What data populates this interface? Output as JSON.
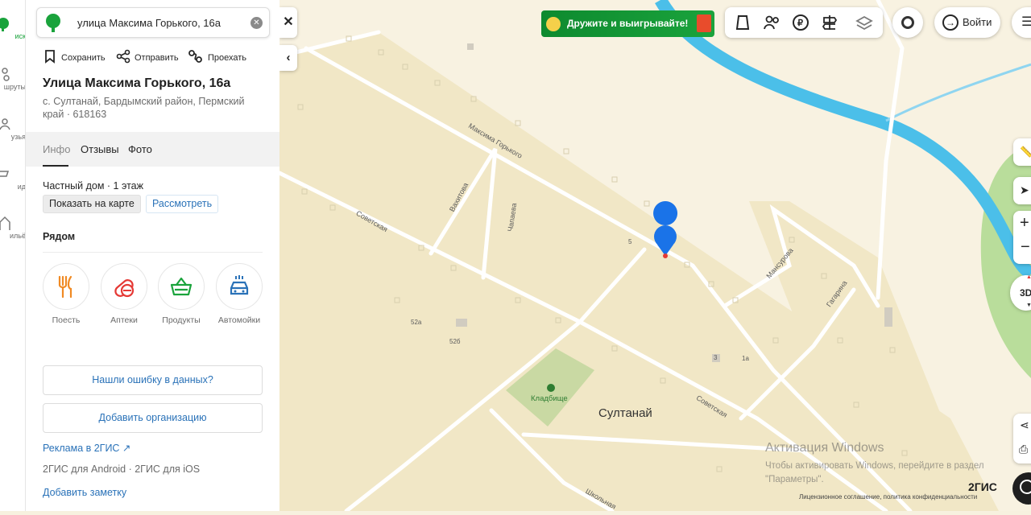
{
  "rail": {
    "items": [
      {
        "label": "иск",
        "icon": "search-icon"
      },
      {
        "label": "шруты",
        "icon": "route-icon"
      },
      {
        "label": "узья",
        "icon": "friends-icon"
      },
      {
        "label": "ид",
        "icon": "guide-icon"
      },
      {
        "label": "ильё",
        "icon": "housing-icon"
      }
    ]
  },
  "search": {
    "value": "улица Максима Горького, 16а",
    "clear_icon": "close-circle-icon"
  },
  "actions": {
    "save": "Сохранить",
    "share": "Отправить",
    "route": "Проехать"
  },
  "place": {
    "title": "Улица Максима Горького, 16а",
    "address": "с. Султанай, Бардымский район, Пермский край · 618163"
  },
  "tabs": {
    "info": "Инфо",
    "reviews": "Отзывы",
    "photo": "Фото"
  },
  "details": {
    "property": "Частный дом · 1 этаж",
    "show_on_map": "Показать на карте",
    "inspect": "Рассмотреть"
  },
  "nearby": {
    "title": "Рядом",
    "categories": [
      {
        "label": "Поесть",
        "icon": "fork-knife-icon"
      },
      {
        "label": "Аптеки",
        "icon": "pill-icon"
      },
      {
        "label": "Продукты",
        "icon": "basket-icon"
      },
      {
        "label": "Автомойки",
        "icon": "car-wash-icon"
      }
    ]
  },
  "footer": {
    "report_error": "Нашли ошибку в данных?",
    "add_org": "Добавить организацию",
    "ads": "Реклама в 2ГИС ↗",
    "apps": "2ГИС для Android · 2ГИС для iOS",
    "add_note": "Добавить заметку"
  },
  "map": {
    "promo": "Дружите и выигрывайте!",
    "login": "Войти",
    "labels": {
      "maxim": "Максима Горького",
      "vakhitova": "Вахитова",
      "chapaeva": "Чапаева",
      "sovetskaya1": "Советская",
      "sovetskaya2": "Советская",
      "mansurova": "Мансурова",
      "gagarina": "Гагарина",
      "shkolnaya": "Школьная",
      "cemetery": "Кладбище",
      "village": "Султанай",
      "h5": "5",
      "h52a": "52а",
      "h52b": "52б",
      "h1a": "1а",
      "h3": "3"
    },
    "watermark_title": "Активация Windows",
    "watermark_text": "Чтобы активировать Windows, перейдите в раздел \"Параметры\".",
    "logo": "2ГИС",
    "legal": "Лицензионное соглашение, политика конфиденциальности",
    "three_d": "3D",
    "colors": {
      "accent": "#2a72b8",
      "brand": "#1aa33c",
      "river": "#33b3e6",
      "land": "#f2e9c9",
      "marker": "#0a84ff"
    }
  }
}
